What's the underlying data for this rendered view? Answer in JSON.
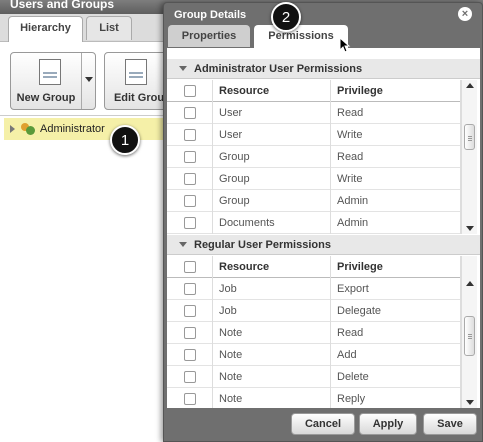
{
  "background": {
    "title": "Users and Groups",
    "tabs": [
      {
        "label": "Hierarchy"
      },
      {
        "label": "List"
      }
    ],
    "toolbar": {
      "new_group": "New Group",
      "edit_group": "Edit Grou"
    },
    "tree": {
      "root_label": "Administrator"
    }
  },
  "callouts": {
    "one": "1",
    "two": "2"
  },
  "dialog": {
    "title": "Group Details",
    "close_glyph": "×",
    "tabs": {
      "properties": "Properties",
      "permissions": "Permissions"
    },
    "sections": [
      {
        "title": "Administrator User Permissions",
        "columns": {
          "resource": "Resource",
          "privilege": "Privilege"
        },
        "rows": [
          {
            "resource": "User",
            "privilege": "Read"
          },
          {
            "resource": "User",
            "privilege": "Write"
          },
          {
            "resource": "Group",
            "privilege": "Read"
          },
          {
            "resource": "Group",
            "privilege": "Write"
          },
          {
            "resource": "Group",
            "privilege": "Admin"
          },
          {
            "resource": "Documents",
            "privilege": "Admin"
          }
        ]
      },
      {
        "title": "Regular User Permissions",
        "columns": {
          "resource": "Resource",
          "privilege": "Privilege"
        },
        "rows": [
          {
            "resource": "Job",
            "privilege": "Export"
          },
          {
            "resource": "Job",
            "privilege": "Delegate"
          },
          {
            "resource": "Note",
            "privilege": "Read"
          },
          {
            "resource": "Note",
            "privilege": "Add"
          },
          {
            "resource": "Note",
            "privilege": "Delete"
          },
          {
            "resource": "Note",
            "privilege": "Reply"
          }
        ]
      }
    ],
    "footer": {
      "cancel": "Cancel",
      "apply": "Apply",
      "save": "Save"
    }
  }
}
